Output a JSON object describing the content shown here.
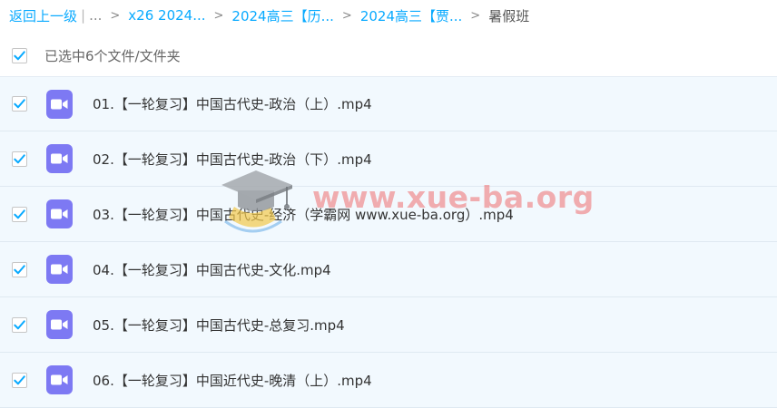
{
  "breadcrumb": {
    "back": "返回上一级",
    "separator_pipe": "|",
    "ellipsis": "...",
    "arrow": ">",
    "items": [
      "x26 2024...",
      "2024高三【历...",
      "2024高三【贾..."
    ],
    "current": "暑假班"
  },
  "selection": {
    "checked": true,
    "text": "已选中6个文件/文件夹"
  },
  "files": [
    {
      "name": "01.【一轮复习】中国古代史-政治（上）.mp4",
      "checked": true,
      "icon": "video-icon"
    },
    {
      "name": "02.【一轮复习】中国古代史-政治（下）.mp4",
      "checked": true,
      "icon": "video-icon"
    },
    {
      "name": "03.【一轮复习】中国古代史-经济（学霸网 www.xue-ba.org）.mp4",
      "checked": true,
      "icon": "video-icon"
    },
    {
      "name": "04.【一轮复习】中国古代史-文化.mp4",
      "checked": true,
      "icon": "video-icon"
    },
    {
      "name": "05.【一轮复习】中国古代史-总复习.mp4",
      "checked": true,
      "icon": "video-icon"
    },
    {
      "name": "06.【一轮复习】中国近代史-晚清（上）.mp4",
      "checked": true,
      "icon": "video-icon"
    }
  ],
  "watermark": {
    "text": "www.xue-ba.org"
  },
  "colors": {
    "link": "#09aaff",
    "checkmark": "#09aaff",
    "video_icon": "#7d79f3",
    "row_background": "#f2f9fe",
    "watermark": "#ee6e6e"
  }
}
